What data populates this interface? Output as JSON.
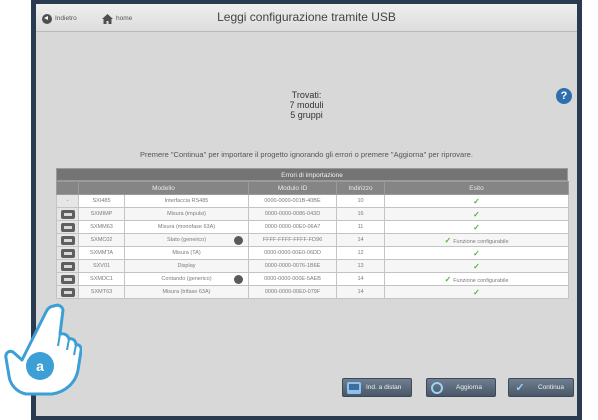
{
  "topbar": {
    "back_label": "Indietro",
    "home_label": "home",
    "title": "Leggi configurazione tramite USB"
  },
  "summary": {
    "line1": "Trovati:",
    "line2": "7 moduli",
    "line3": "5 gruppi"
  },
  "help_icon": "?",
  "instruction": "Premere \"Continua\" per importare il progetto ignorando gli errori o premere \"Aggiorna\" per riprovare.",
  "table": {
    "title": "Errori di importazione",
    "headers": [
      "",
      "Modello",
      "",
      "Modulo ID",
      "Indirizzo",
      "Esito"
    ],
    "rows": [
      {
        "icon": false,
        "dash": "-",
        "code": "SXI485",
        "model": "Interfaccia RS485",
        "dot": false,
        "id": "0000-0000-001B-40BE",
        "addr": "10",
        "esito": ""
      },
      {
        "icon": true,
        "code": "SXMIMP",
        "model": "Misura (impulsi)",
        "dot": false,
        "id": "0000-0000-0086-043D",
        "addr": "16",
        "esito": ""
      },
      {
        "icon": true,
        "code": "SXMM63",
        "model": "Misura (monofase 63A)",
        "dot": false,
        "id": "0000-0000-00E0-06A7",
        "addr": "11",
        "esito": ""
      },
      {
        "icon": true,
        "code": "SXMC02",
        "model": "Stato (generico)",
        "dot": true,
        "id": "FFFF-FFFF-FFFF-FD96",
        "addr": "14",
        "esito": "Funzione configurabile"
      },
      {
        "icon": true,
        "code": "SXMMTA",
        "model": "Misura (TA)",
        "dot": false,
        "id": "0000-0000-00E0-06DD",
        "addr": "12",
        "esito": ""
      },
      {
        "icon": true,
        "code": "SXV01",
        "model": "Display",
        "dot": false,
        "id": "0000-0000-0076-1B6E",
        "addr": "13",
        "esito": ""
      },
      {
        "icon": true,
        "code": "SXMDC1",
        "model": "Contando (generico)",
        "dot": true,
        "id": "0000-0000-000E-5AEB",
        "addr": "14",
        "esito": "Funzione configurabile"
      },
      {
        "icon": true,
        "code": "SXMT63",
        "model": "Misura (trifase 63A)",
        "dot": false,
        "id": "0000-0000-00E0-079F",
        "addr": "14",
        "esito": ""
      }
    ]
  },
  "buttons": {
    "ind_label": "Ind. a distan",
    "aggiorna_label": "Aggiorna",
    "continua_label": "Continua"
  },
  "annotation": {
    "letter": "a"
  },
  "colors": {
    "accent": "#2f6fae",
    "success": "#52b43e",
    "frame": "#2b3b4f"
  }
}
